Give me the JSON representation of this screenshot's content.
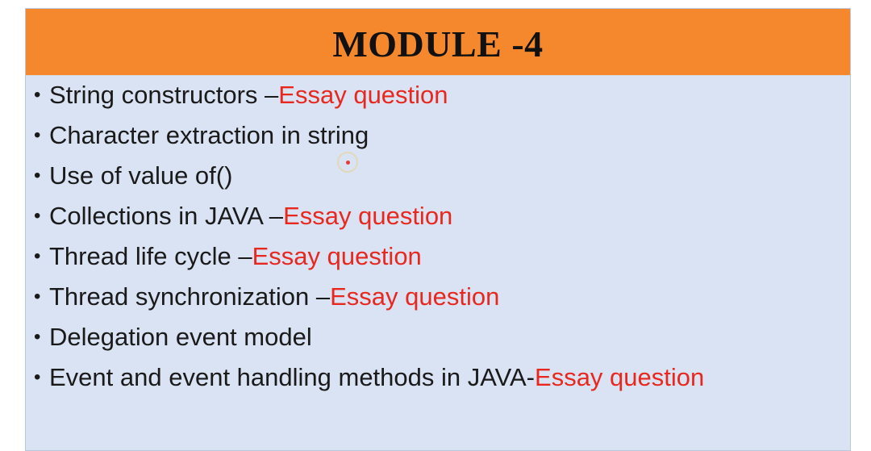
{
  "slide": {
    "title": "MODULE -4",
    "bullet_symbol": "•",
    "items": [
      {
        "text": "String constructors – ",
        "note": "Essay question"
      },
      {
        "text": "Character extraction in string",
        "note": ""
      },
      {
        "text": "Use of value of()",
        "note": ""
      },
      {
        "text": "Collections in JAVA – ",
        "note": "Essay question"
      },
      {
        "text": "Thread life cycle – ",
        "note": "Essay question"
      },
      {
        "text": "Thread synchronization – ",
        "note": "Essay question"
      },
      {
        "text": "Delegation event model",
        "note": ""
      },
      {
        "text": "Event and event handling methods in JAVA- ",
        "note": "Essay question"
      }
    ]
  },
  "colors": {
    "header_bg": "#f5882c",
    "body_bg": "#dae3f3",
    "note_text": "#e8281e"
  },
  "icons": {
    "pointer": "laser-pointer-icon"
  }
}
